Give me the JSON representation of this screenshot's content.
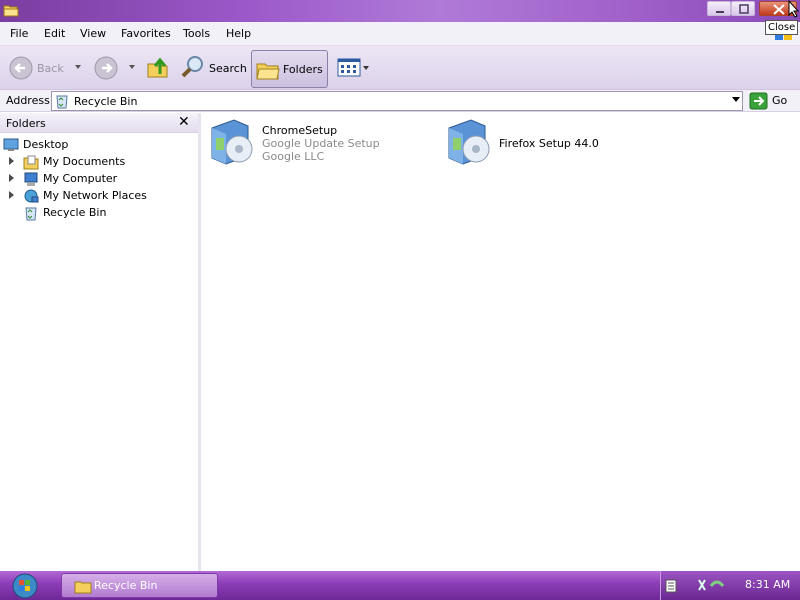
{
  "window": {
    "title_icon": "folder-icon",
    "buttons": {
      "minimize": "minimize-icon",
      "maximize": "maximize-icon",
      "close": "close-icon"
    },
    "tooltip": "Close"
  },
  "menu": [
    "File",
    "Edit",
    "View",
    "Favorites",
    "Tools",
    "Help"
  ],
  "toolbar": {
    "back": "Back",
    "search": "Search",
    "folders": "Folders"
  },
  "address": {
    "label": "Address",
    "value": "Recycle Bin",
    "go": "Go"
  },
  "folders_pane": {
    "title": "Folders",
    "close": "✕",
    "items": [
      {
        "label": "Desktop",
        "icon": "desktop-icon"
      },
      {
        "label": "My Documents",
        "icon": "documents-folder-icon"
      },
      {
        "label": "My Computer",
        "icon": "computer-icon"
      },
      {
        "label": "My Network Places",
        "icon": "network-icon"
      },
      {
        "label": "Recycle Bin",
        "icon": "recycle-bin-icon"
      }
    ]
  },
  "files": [
    {
      "name": "ChromeSetup",
      "line2": "Google Update Setup",
      "line3": "Google LLC",
      "icon": "installer-icon"
    },
    {
      "name": "Firefox Setup 44.0",
      "icon": "installer-icon"
    }
  ],
  "taskbar": {
    "task": "Recycle Bin",
    "clock": "8:31 AM"
  },
  "colors": {
    "titlebar": "#9a58c8",
    "taskbar": "#8e3fb8"
  }
}
